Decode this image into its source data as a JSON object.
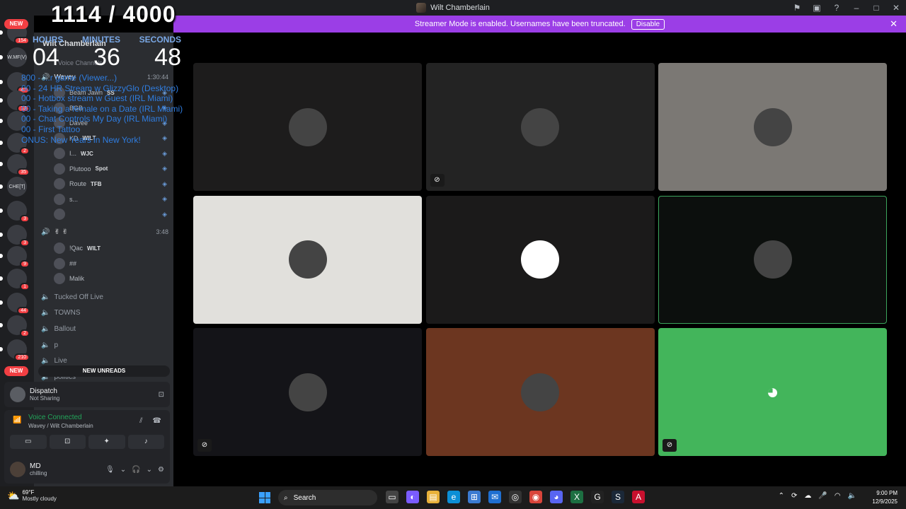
{
  "window": {
    "title": "Wilt Chamberlain"
  },
  "banner": {
    "text": "Streamer Mode is enabled. Usernames have been truncated.",
    "button": "Disable"
  },
  "overlay": {
    "count": "1114 / 4000",
    "labels": [
      "HOURS",
      "MINUTES",
      "SECONDS"
    ],
    "values": [
      "04",
      "36",
      "48"
    ],
    "schedule": [
      "800 - ...r game (Viewer...)",
      "00 - 24 HR Stream w GlizzyGlo (Desktop)",
      "00 - Hotbox stream w Guest (IRL Miami)",
      "00 - Taking a female on a Date (IRL Miami)",
      "00 - Chat Controls My Day (IRL Miami)",
      "00 - First Tattoo",
      "ONUS: New Years in New York!"
    ]
  },
  "guilds": [
    {
      "label": "",
      "badge": "154"
    },
    {
      "label": "W.MF(V)",
      "badge": ""
    },
    {
      "label": "",
      "badge": "47"
    },
    {
      "label": "",
      "badge": "13"
    },
    {
      "label": "",
      "badge": ""
    },
    {
      "label": "",
      "badge": "2"
    },
    {
      "label": "",
      "badge": "35"
    },
    {
      "label": "CHE[T]",
      "badge": ""
    },
    {
      "label": "",
      "badge": "3"
    },
    {
      "label": "",
      "badge": "3"
    },
    {
      "label": "",
      "badge": "9"
    },
    {
      "label": "",
      "badge": "1"
    },
    {
      "label": "",
      "badge": "44"
    },
    {
      "label": "",
      "badge": "2"
    },
    {
      "label": "",
      "badge": "210"
    }
  ],
  "new_tag": "NEW",
  "sidebar": {
    "server": "Wilt Chamberlain",
    "category": "Voice Channels",
    "channel1": {
      "name": "Wavey",
      "time": "1:30:44"
    },
    "users1": [
      {
        "name": "Beam Jawn",
        "tag": "SS"
      },
      {
        "name": "BGB",
        "tag": ""
      },
      {
        "name": "Davee",
        "tag": ""
      },
      {
        "name": "KD",
        "tag": "WILT"
      },
      {
        "name": "I...",
        "tag": "WJC"
      },
      {
        "name": "Plutooo",
        "tag": "Spot"
      },
      {
        "name": "Route",
        "tag": "TFB"
      },
      {
        "name": "s...",
        "tag": ""
      },
      {
        "name": "",
        "tag": ""
      }
    ],
    "channel2": {
      "name": "✌ ✌",
      "time": "3:48"
    },
    "users2": [
      {
        "name": "!Qac",
        "tag": "WILT"
      },
      {
        "name": "##",
        "tag": ""
      },
      {
        "name": "Malik",
        "tag": ""
      }
    ],
    "channels": [
      "Tucked Off Live",
      "TOWNS",
      "Ballout",
      "p",
      "Live",
      "politics"
    ],
    "new_unreads": "NEW UNREADS"
  },
  "dispatch": {
    "title": "Dispatch",
    "status": "Not Sharing"
  },
  "voice": {
    "status": "Voice Connected",
    "location": "Wavey / Wilt Chamberlain"
  },
  "me": {
    "name": "MD",
    "status": "chilling"
  },
  "tiles": [
    {
      "bg": "#1d1c1c",
      "muted": false
    },
    {
      "bg": "#232323",
      "muted": true
    },
    {
      "bg": "#7b7874",
      "muted": false
    },
    {
      "bg": "#e1e0dc",
      "muted": false
    },
    {
      "bg": "#1b1a1a",
      "muted": false
    },
    {
      "bg": "#0c0f0d",
      "muted": false
    },
    {
      "bg": "#141418",
      "muted": true
    },
    {
      "bg": "#6c3620",
      "muted": false
    },
    {
      "bg": "#43b55b",
      "muted": true
    }
  ],
  "taskbar": {
    "weather_temp": "69°F",
    "weather_desc": "Mostly cloudy",
    "search": "Search",
    "time": "9:00 PM",
    "date": "12/9/2025"
  }
}
